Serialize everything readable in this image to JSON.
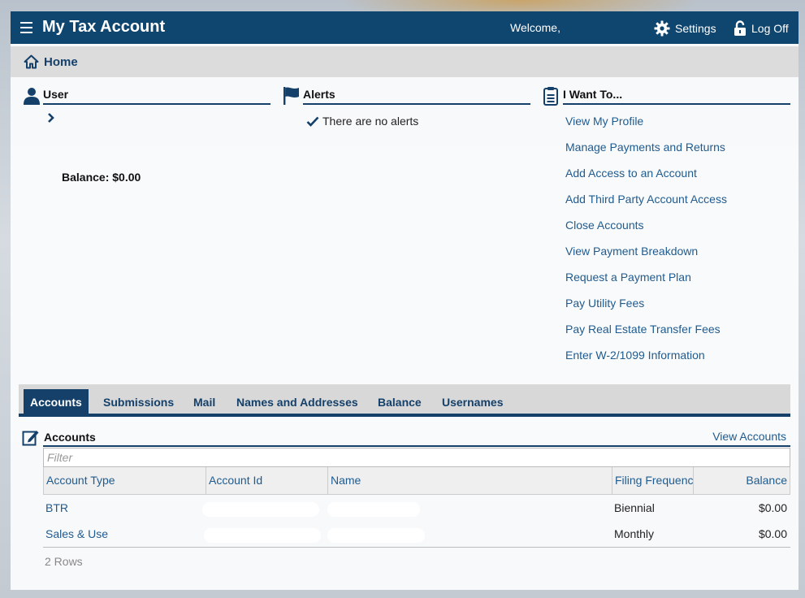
{
  "header": {
    "menu_icon": "hamburger-menu-icon",
    "title": "My Tax Account",
    "welcome": "Welcome,",
    "settings_label": "Settings",
    "logoff_label": "Log Off",
    "bar_color": "#0f4670"
  },
  "breadcrumb": {
    "icon": "home-icon",
    "label": "Home"
  },
  "user_panel": {
    "title": "User",
    "icon": "user-icon",
    "expand_icon": "chevron-right-icon",
    "balance": "Balance: $0.00"
  },
  "alerts_panel": {
    "title": "Alerts",
    "icon": "flag-icon",
    "message": "There are no alerts"
  },
  "iwant_panel": {
    "title": "I Want To...",
    "icon": "clipboard-icon",
    "links": [
      "View My Profile",
      "Manage Payments and Returns",
      "Add Access to an Account",
      "Add Third Party Account Access",
      "Close Accounts",
      "View Payment Breakdown",
      "Request a Payment Plan",
      "Pay Utility Fees",
      "Pay Real Estate Transfer Fees",
      "Enter W-2/1099 Information"
    ]
  },
  "tabs": [
    "Accounts",
    "Submissions",
    "Mail",
    "Names and Addresses",
    "Balance",
    "Usernames"
  ],
  "active_tab": "Accounts",
  "accounts": {
    "title": "Accounts",
    "icon": "edit-icon",
    "view_link": "View Accounts",
    "filter_placeholder": "Filter",
    "columns": [
      "Account Type",
      "Account Id",
      "Name",
      "Filing Frequenc",
      "Balance"
    ],
    "rows": [
      {
        "type": "BTR",
        "frequency": "Biennial",
        "balance": "$0.00"
      },
      {
        "type": "Sales & Use",
        "frequency": "Monthly",
        "balance": "$0.00"
      }
    ],
    "row_count": "2 Rows"
  }
}
